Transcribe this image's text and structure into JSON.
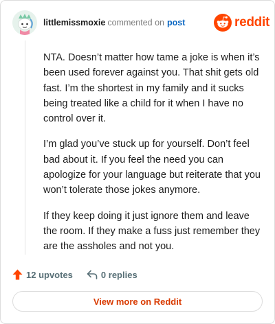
{
  "header": {
    "username": "littlemissmoxie",
    "action_text": "commented on",
    "post_link": "post",
    "avatar_icon": "snoo-avatar-icon",
    "brand_icon": "reddit-logo-icon",
    "brand_word": "reddit"
  },
  "comment": {
    "paragraphs": [
      "NTA. Doesn’t matter how tame a joke is when it’s been used forever against you. That shit gets old fast. I’m the shortest in my family and it sucks being treated like a child for it when I have no control over it.",
      "I’m glad you’ve stuck up for yourself. Don’t feel bad about it. If you feel the need you can apologize for your language but reiterate that you won’t tolerate those jokes anymore.",
      "If they keep doing it just ignore them and leave the room. If they make a fuss just remember they are the assholes and not you."
    ]
  },
  "footer": {
    "upvotes_label": "12 upvotes",
    "replies_label": "0 replies",
    "upvote_icon": "upvote-arrow-icon",
    "reply_icon": "reply-arrow-icon"
  },
  "view_more": {
    "label": "View more on Reddit"
  },
  "colors": {
    "brand": "#ff4500",
    "link": "#0b67c2",
    "button_text": "#d93a00",
    "muted": "#576f76"
  }
}
